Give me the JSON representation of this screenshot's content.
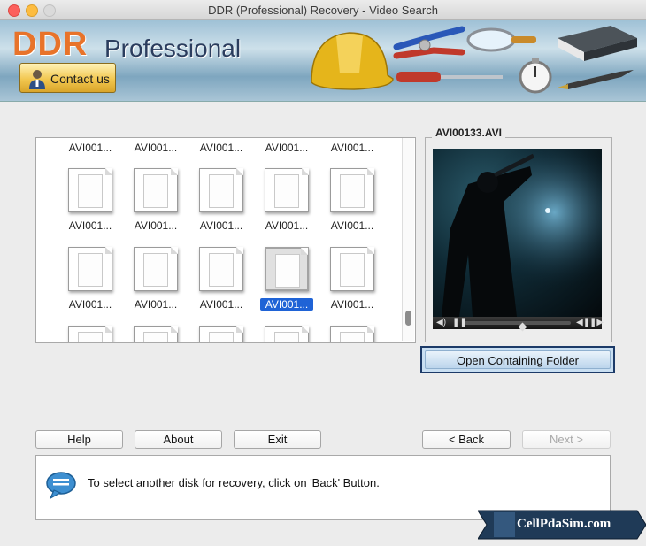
{
  "window": {
    "title": "DDR (Professional) Recovery - Video Search"
  },
  "banner": {
    "brand": "DDR",
    "product": "Professional",
    "contact_label": "Contact us"
  },
  "files": {
    "rows": [
      [
        "AVI001...",
        "AVI001...",
        "AVI001...",
        "AVI001...",
        "AVI001..."
      ],
      [
        "AVI001...",
        "AVI001...",
        "AVI001...",
        "AVI001...",
        "AVI001..."
      ],
      [
        "AVI001...",
        "AVI001...",
        "AVI001...",
        "AVI001...",
        "AVI001..."
      ],
      [
        "",
        "",
        "",
        "",
        ""
      ]
    ],
    "selected": {
      "row": 2,
      "col": 3
    }
  },
  "preview": {
    "title": "AVI00133.AVI"
  },
  "buttons": {
    "open_folder": "Open Containing Folder",
    "help": "Help",
    "about": "About",
    "exit": "Exit",
    "back": "< Back",
    "next": "Next >"
  },
  "message": "To select another disk for recovery, click on 'Back' Button.",
  "watermark": "CellPdaSim.com"
}
